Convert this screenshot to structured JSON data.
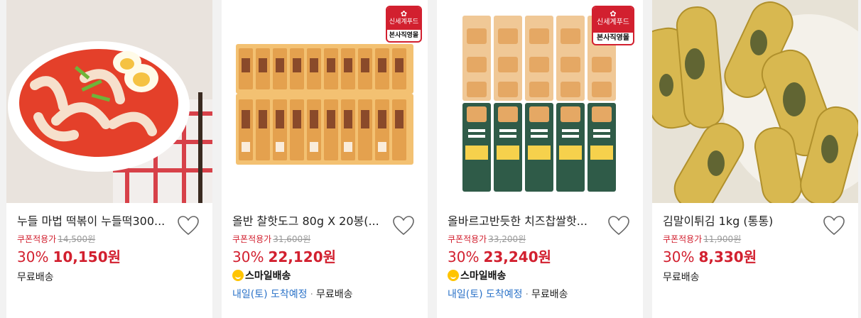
{
  "products": [
    {
      "title": "누들 마법 떡볶이 누들떡300...",
      "coupon_label": "쿠폰적용가",
      "original_price": "14,500원",
      "discount": "30%",
      "price": "10,150원",
      "shipping": "무료배송",
      "image_icon": "tteokbokki-image"
    },
    {
      "title": "올반 찰핫도그 80g X 20봉(...",
      "coupon_label": "쿠폰적용가",
      "original_price": "31,600원",
      "discount": "30%",
      "price": "22,120원",
      "badge_top": "신세계푸드",
      "badge_bottom": "본사직영몰",
      "smile_delivery": "스마일배송",
      "arrival": "내일(토) 도착예정",
      "separator": "·",
      "shipping": "무료배송",
      "image_icon": "hotdog-packs-image"
    },
    {
      "title": "올바르고반듯한 치즈찹쌀핫...",
      "coupon_label": "쿠폰적용가",
      "original_price": "33,200원",
      "discount": "30%",
      "price": "23,240원",
      "badge_top": "신세계푸드",
      "badge_bottom": "본사직영몰",
      "smile_delivery": "스마일배송",
      "arrival": "내일(토) 도착예정",
      "separator": "·",
      "shipping": "무료배송",
      "image_icon": "cheese-hotdog-packs-image"
    },
    {
      "title": "김말이튀김 1kg (통통)",
      "coupon_label": "쿠폰적용가",
      "original_price": "11,900원",
      "discount": "30%",
      "price": "8,330원",
      "shipping": "무료배송",
      "image_icon": "fried-seaweed-roll-image"
    }
  ],
  "colors": {
    "accent_red": "#d2202f",
    "link_blue": "#2a72c8",
    "smile_yellow": "#ffc400",
    "background": "#f2f2f2"
  }
}
